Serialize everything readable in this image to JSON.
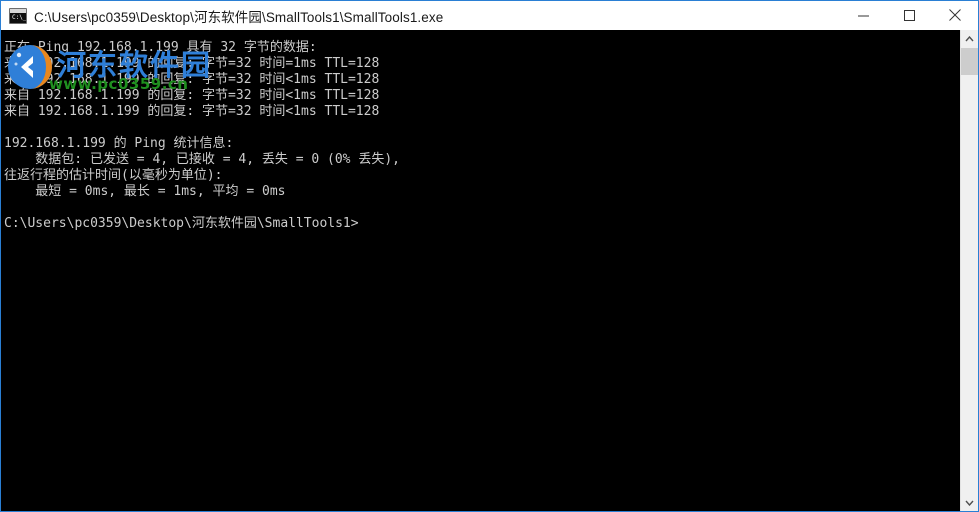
{
  "window": {
    "title": "C:\\Users\\pc0359\\Desktop\\河东软件园\\SmallTools1\\SmallTools1.exe",
    "icon": "console-app-icon",
    "icon_prompt": "C:\\_",
    "controls": {
      "minimize_label": "Minimize",
      "maximize_label": "Maximize",
      "close_label": "Close"
    },
    "border_color": "#2a7fd4"
  },
  "console": {
    "background_color": "#000000",
    "text_color": "#cccccc",
    "lines": [
      "正在 Ping 192.168.1.199 具有 32 字节的数据:",
      "来自 192.168.1.199 的回复: 字节=32 时间=1ms TTL=128",
      "来自 192.168.1.199 的回复: 字节=32 时间<1ms TTL=128",
      "来自 192.168.1.199 的回复: 字节=32 时间<1ms TTL=128",
      "来自 192.168.1.199 的回复: 字节=32 时间<1ms TTL=128",
      "",
      "192.168.1.199 的 Ping 统计信息:",
      "    数据包: 已发送 = 4, 已接收 = 4, 丢失 = 0 (0% 丢失),",
      "往返行程的估计时间(以毫秒为单位):",
      "    最短 = 0ms, 最长 = 1ms, 平均 = 0ms",
      "",
      "C:\\Users\\pc0359\\Desktop\\河东软件园\\SmallTools1>"
    ],
    "text": "正在 Ping 192.168.1.199 具有 32 字节的数据:\n来自 192.168.1.199 的回复: 字节=32 时间=1ms TTL=128\n来自 192.168.1.199 的回复: 字节=32 时间<1ms TTL=128\n来自 192.168.1.199 的回复: 字节=32 时间<1ms TTL=128\n来自 192.168.1.199 的回复: 字节=32 时间<1ms TTL=128\n\n192.168.1.199 的 Ping 统计信息:\n    数据包: 已发送 = 4, 已接收 = 4, 丢失 = 0 (0% 丢失),\n往返行程的估计时间(以毫秒为单位):\n    最短 = 0ms, 最长 = 1ms, 平均 = 0ms\n\nC:\\Users\\pc0359\\Desktop\\河东软件园\\SmallTools1>"
  },
  "watermark": {
    "brand": "河东软件园",
    "brand_color": "#2f7fd8",
    "url": "www.pc0359.cn",
    "url_color": "#1f8f1f",
    "logo": "hedong-circle-logo"
  },
  "scrollbar": {
    "up_arrow": "chevron-up-icon",
    "down_arrow": "chevron-down-icon",
    "thumb": "scrollbar-thumb"
  }
}
